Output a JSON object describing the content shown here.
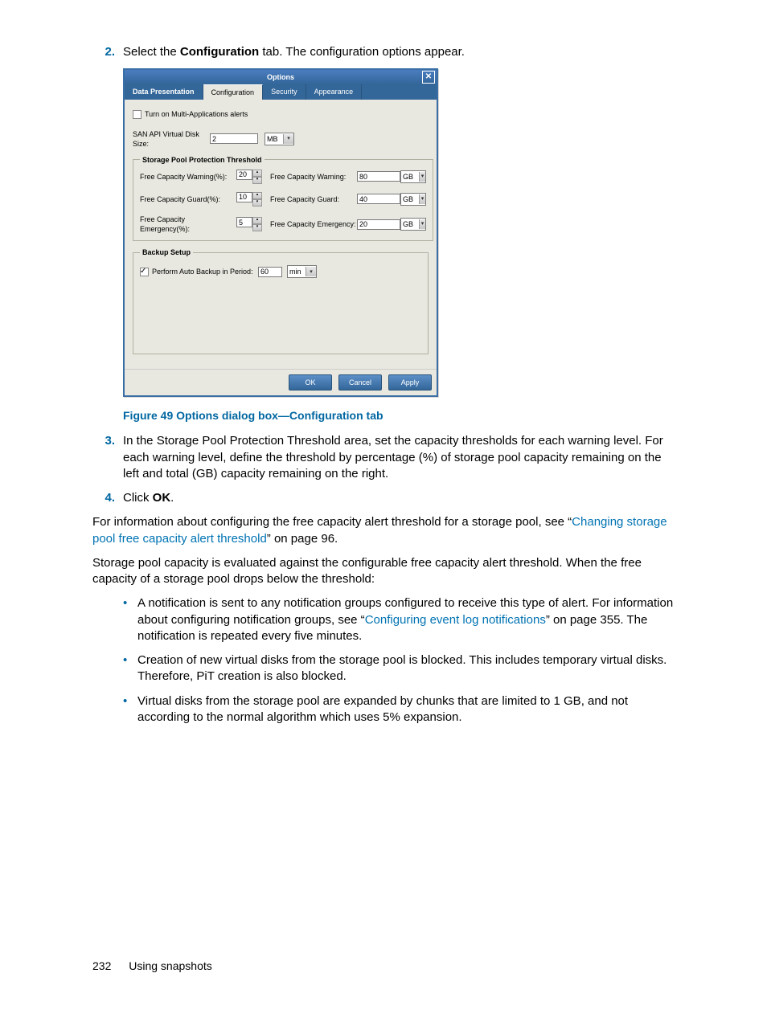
{
  "step2": {
    "num": "2.",
    "pre": "Select the ",
    "bold": "Configuration",
    "post": " tab. The configuration options appear."
  },
  "dialog": {
    "title": "Options",
    "tabs": {
      "dp": "Data Presentation",
      "cfg": "Configuration",
      "sec": "Security",
      "app": "Appearance"
    },
    "multiapp": "Turn on Multi-Applications alerts",
    "vdisk_lbl": "SAN API Virtual Disk Size:",
    "vdisk_val": "2",
    "vdisk_unit": "MB",
    "group_thresh": "Storage Pool Protection Threshold",
    "warn_pct_lbl": "Free Capacity Warning(%):",
    "warn_pct": "20",
    "warn_lbl": "Free Capacity Warning:",
    "warn_val": "80",
    "warn_unit": "GB",
    "guard_pct_lbl": "Free Capacity Guard(%):",
    "guard_pct": "10",
    "guard_lbl": "Free Capacity Guard:",
    "guard_val": "40",
    "guard_unit": "GB",
    "emer_pct_lbl": "Free Capacity Emergency(%):",
    "emer_pct": "5",
    "emer_lbl": "Free Capacity Emergency:",
    "emer_val": "20",
    "emer_unit": "GB",
    "group_backup": "Backup Setup",
    "backup_chk": "Perform Auto Backup in Period:",
    "backup_val": "60",
    "backup_unit": "min",
    "ok": "OK",
    "cancel": "Cancel",
    "apply": "Apply"
  },
  "caption": "Figure 49 Options dialog box—Configuration tab",
  "step3": {
    "num": "3.",
    "text": "In the Storage Pool Protection Threshold area, set the capacity thresholds for each warning level. For each warning level, define the threshold by percentage (%) of storage pool capacity remaining on the left and total (GB) capacity remaining on the right."
  },
  "step4": {
    "num": "4.",
    "pre": "Click ",
    "bold": "OK",
    "post": "."
  },
  "para1": {
    "pre": "For information about configuring the free capacity alert threshold for a storage pool, see “",
    "link": "Changing storage pool free capacity alert threshold",
    "post": "” on page 96."
  },
  "para2": "Storage pool capacity is evaluated against the configurable free capacity alert threshold. When the free capacity of a storage pool drops below the threshold:",
  "bul1": {
    "pre": "A notification is sent to any notification groups configured to receive this type of alert. For information about configuring notification groups, see “",
    "link": "Configuring event log notifications",
    "post": "” on page 355. The notification is repeated every five minutes."
  },
  "bul2": "Creation of new virtual disks from the storage pool is blocked. This includes temporary virtual disks. Therefore, PiT creation is also blocked.",
  "bul3": "Virtual disks from the storage pool are expanded by chunks that are limited to 1 GB, and not according to the normal algorithm which uses 5% expansion.",
  "footer": {
    "page": "232",
    "section": "Using snapshots"
  }
}
